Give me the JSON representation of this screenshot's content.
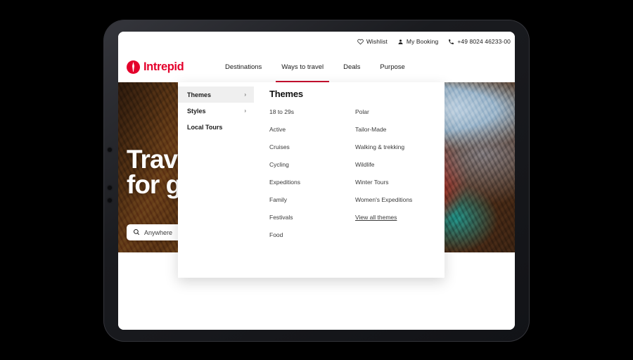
{
  "device": {
    "type": "tablet"
  },
  "browser_page": {
    "utility_bar": [
      {
        "icon": "heart-icon",
        "label": "Wishlist"
      },
      {
        "icon": "user-icon",
        "label": "My Booking"
      },
      {
        "icon": "phone-icon",
        "label": "+49 8024 46233-00"
      }
    ],
    "brand": {
      "name": "Intrepid",
      "logo_icon": "intrepid-compass-logo",
      "color": "#e4002b"
    },
    "nav": [
      {
        "label": "Destinations",
        "active": false
      },
      {
        "label": "Ways to travel",
        "active": true
      },
      {
        "label": "Deals",
        "active": false
      },
      {
        "label": "Purpose",
        "active": false
      }
    ],
    "active_nav_underline_color": "#c8102e",
    "hero": {
      "title": "Travel\nfor good",
      "search": {
        "icon": "search-icon",
        "placeholder": "Anywhere",
        "value": "Anywhere"
      }
    },
    "megamenu": {
      "categories": [
        {
          "label": "Themes",
          "selected": true,
          "chevron": "›"
        },
        {
          "label": "Styles",
          "selected": false,
          "chevron": "›"
        },
        {
          "label": "Local Tours",
          "selected": false,
          "chevron": ""
        }
      ],
      "panel_heading": "Themes",
      "columns": [
        {
          "links": [
            {
              "label": "18 to 29s",
              "underlined": false
            },
            {
              "label": "Active",
              "underlined": false
            },
            {
              "label": "Cruises",
              "underlined": false
            },
            {
              "label": "Cycling",
              "underlined": false
            },
            {
              "label": "Expeditions",
              "underlined": false
            },
            {
              "label": "Family",
              "underlined": false
            },
            {
              "label": "Festivals",
              "underlined": false
            },
            {
              "label": "Food",
              "underlined": false
            }
          ]
        },
        {
          "links": [
            {
              "label": "Polar",
              "underlined": false
            },
            {
              "label": "Tailor-Made",
              "underlined": false
            },
            {
              "label": "Walking & trekking",
              "underlined": false
            },
            {
              "label": "Wildlife",
              "underlined": false
            },
            {
              "label": "Winter Tours",
              "underlined": false
            },
            {
              "label": "Women's Expeditions",
              "underlined": false
            },
            {
              "label": "View all themes",
              "underlined": true
            }
          ]
        }
      ]
    }
  }
}
